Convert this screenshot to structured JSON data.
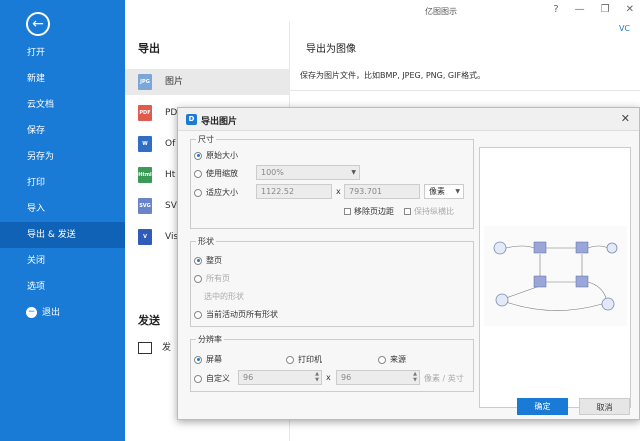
{
  "app_title": "亿图图示",
  "window_controls": [
    "?",
    "—",
    "❐",
    "✕"
  ],
  "user_badge": "VC",
  "sidebar": {
    "items": [
      {
        "label": "打开"
      },
      {
        "label": "新建"
      },
      {
        "label": "云文档"
      },
      {
        "label": "保存"
      },
      {
        "label": "另存为"
      },
      {
        "label": "打印"
      },
      {
        "label": "导入"
      },
      {
        "label": "导出 & 发送"
      },
      {
        "label": "关闭"
      },
      {
        "label": "选项"
      },
      {
        "label": "退出"
      }
    ]
  },
  "export": {
    "title": "导出",
    "formats": [
      {
        "label": "图片",
        "icon": "JPG",
        "color": "#7aa6d8"
      },
      {
        "label": "PD",
        "icon": "PDF",
        "color": "#e05a4e"
      },
      {
        "label": "Of",
        "icon": "W",
        "color": "#2f6ec4"
      },
      {
        "label": "Ht",
        "icon": "Html",
        "color": "#3c9a57"
      },
      {
        "label": "SV",
        "icon": "SVG",
        "color": "#6a84c9"
      },
      {
        "label": "Vis",
        "icon": "V",
        "color": "#2f5cb8"
      }
    ],
    "send_title": "发送",
    "send_item": "发"
  },
  "info": {
    "title": "导出为图像",
    "desc": "保存为图片文件，比如BMP, JPEG, PNG, GIF格式。"
  },
  "dialog": {
    "title": "导出图片",
    "size": {
      "title": "尺寸",
      "original": "原始大小",
      "scale": "使用缩放",
      "scale_value": "100%",
      "fit": "适应大小",
      "width": "1122.52",
      "x": "x",
      "height": "793.701",
      "unit": "像素",
      "remove_margin": "移除页边距",
      "keep_ratio": "保持纵横比"
    },
    "shape": {
      "title": "形状",
      "page": "整页",
      "all_pages": "所有页",
      "selected": "选中的形状",
      "current_all": "当前活动页所有形状"
    },
    "resolution": {
      "title": "分辨率",
      "screen": "屏幕",
      "printer": "打印机",
      "source": "来源",
      "custom": "自定义",
      "value1": "96",
      "x": "x",
      "value2": "96",
      "unit": "像素 / 英寸"
    },
    "ok": "确定",
    "cancel": "取消"
  }
}
